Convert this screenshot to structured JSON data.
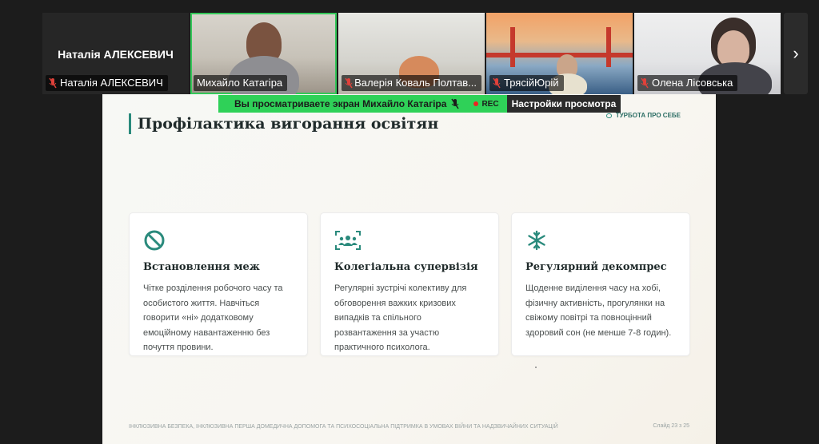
{
  "participants": [
    {
      "big_name": "Наталія АЛЕКСЕВИЧ",
      "name": "Наталія АЛЕКСЕВИЧ",
      "muted": true
    },
    {
      "name": "Михайло Катагіра",
      "muted": false
    },
    {
      "name": "Валерія Коваль Полтав...",
      "muted": true
    },
    {
      "name": "ТрясійЮрій",
      "muted": true
    },
    {
      "name": "Олена Лісовська",
      "muted": true
    }
  ],
  "share_banner": {
    "text": "Вы просматриваете экран",
    "presenter": "Михайло Катагіра",
    "rec": "REC",
    "settings_label": "Настройки просмотра"
  },
  "slide": {
    "title": "Профілактика вигорання освітян",
    "brand": "ТУРБОТА ПРО СЕБЕ",
    "cards": [
      {
        "icon": "prohibit-icon",
        "title": "Встановлення меж",
        "text": "Чітке розділення робочого часу та особистого життя. Навчіться говорити «ні» додатковому емоційному навантаженню без почуття провини."
      },
      {
        "icon": "group-icon",
        "title": "Колегіальна супервізія",
        "text": "Регулярні зустрічі колективу для обговорення важких кризових випадків та спільного розвантаження за участю практичного психолога."
      },
      {
        "icon": "snowflake-icon",
        "title": "Регулярний декомпрес",
        "text": "Щоденне виділення часу на хобі, фізичну активність, прогулянки на свіжому повітрі та повноцінний здоровий сон (не менше 7-8 годин)."
      }
    ],
    "footer": "ІНКЛЮЗИВНА БЕЗПЕКА, ІНКЛЮЗИВНА ПЕРША ДОМЕДИЧНА ДОПОМОГА ТА ПСИХОСОЦІАЛЬНА ПІДТРИМКА В УМОВАХ ВІЙНИ ТА НАДЗВИЧАЙНИХ СИТУАЦІЙ",
    "counter": "Слайд 23 з 25"
  },
  "colors": {
    "accent": "#2a8a7c",
    "share_green": "#2fd158",
    "active_outline": "#34c759"
  }
}
